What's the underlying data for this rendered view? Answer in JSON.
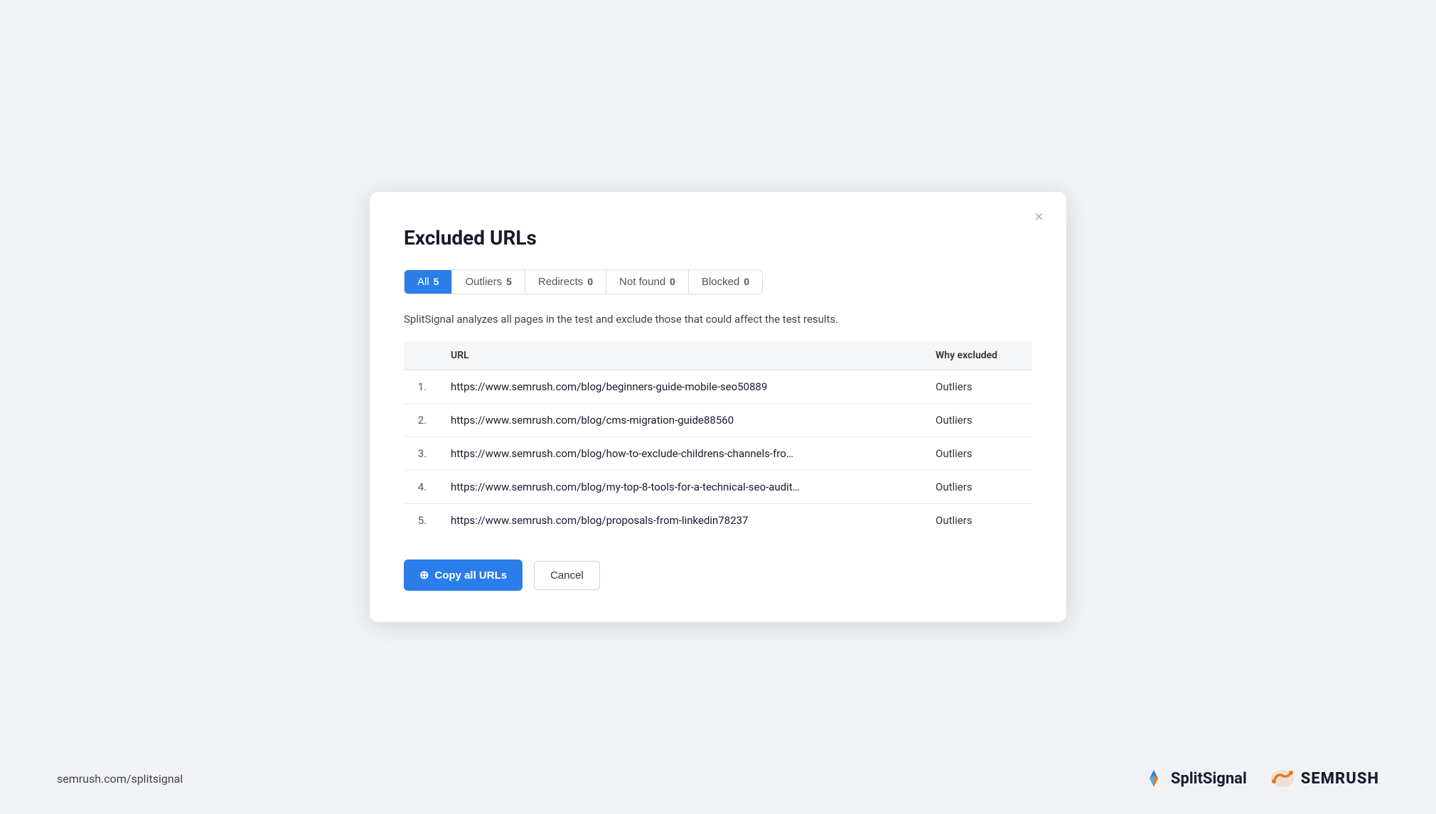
{
  "modal": {
    "title": "Excluded URLs",
    "close_label": "×",
    "description": "SplitSignal analyzes all pages in the test and exclude those that could affect the test results."
  },
  "tabs": [
    {
      "id": "all",
      "label": "All",
      "count": "5",
      "active": true
    },
    {
      "id": "outliers",
      "label": "Outliers",
      "count": "5",
      "active": false
    },
    {
      "id": "redirects",
      "label": "Redirects",
      "count": "0",
      "active": false
    },
    {
      "id": "not-found",
      "label": "Not found",
      "count": "0",
      "active": false
    },
    {
      "id": "blocked",
      "label": "Blocked",
      "count": "0",
      "active": false
    }
  ],
  "table": {
    "headers": [
      "",
      "URL",
      "Why excluded"
    ],
    "rows": [
      {
        "num": "1.",
        "url": "https://www.semrush.com/blog/beginners-guide-mobile-seo50889",
        "reason": "Outliers"
      },
      {
        "num": "2.",
        "url": "https://www.semrush.com/blog/cms-migration-guide88560",
        "reason": "Outliers"
      },
      {
        "num": "3.",
        "url": "https://www.semrush.com/blog/how-to-exclude-childrens-channels-fro…",
        "reason": "Outliers"
      },
      {
        "num": "4.",
        "url": "https://www.semrush.com/blog/my-top-8-tools-for-a-technical-seo-audit…",
        "reason": "Outliers"
      },
      {
        "num": "5.",
        "url": "https://www.semrush.com/blog/proposals-from-linkedin78237",
        "reason": "Outliers"
      }
    ]
  },
  "buttons": {
    "copy_label": "Copy all URLs",
    "cancel_label": "Cancel"
  },
  "footer": {
    "url": "semrush.com/splitsignal",
    "splitsignal": "SplitSignal",
    "semrush": "SEMRUSH"
  },
  "colors": {
    "active_tab_bg": "#2b7de9",
    "copy_btn_bg": "#2b7de9"
  }
}
